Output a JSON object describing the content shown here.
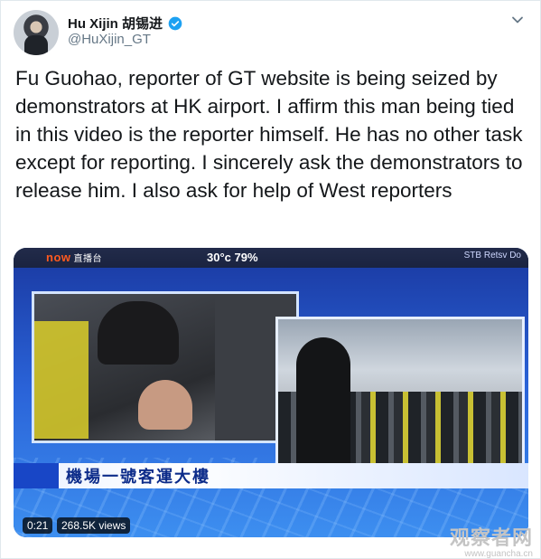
{
  "author": {
    "display_name": "Hu Xijin 胡锡进",
    "handle": "@HuXijin_GT",
    "verified": true,
    "accent_color": "#1da1f2"
  },
  "tweet": {
    "text": "Fu Guohao, reporter of GT website is being seized by demonstrators at HK airport. I affirm this man being tied in this video is the reporter himself. He has no other task except for reporting. I sincerely ask the demonstrators to release him. I also ask for help of West reporters"
  },
  "media": {
    "broadcaster_logo": "now",
    "broadcaster_sub": "直播台",
    "weather": "30°c 79%",
    "stb_text": "STB Retsv Do",
    "caption": "機場一號客運大樓",
    "duration": "0:21",
    "views": "268.5K views"
  },
  "watermark": {
    "main": "观察者网",
    "sub": "www.guancha.cn"
  },
  "icons": {
    "verified": "verified-badge-icon",
    "menu": "chevron-down-icon"
  }
}
